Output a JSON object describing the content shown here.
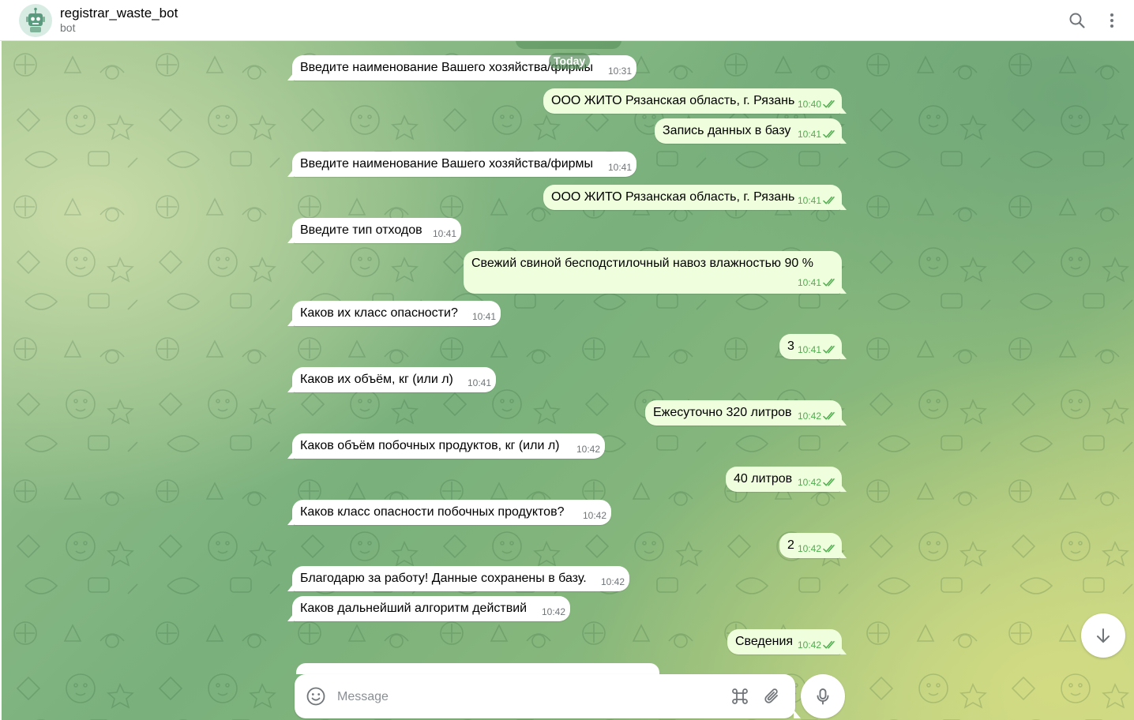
{
  "header": {
    "title": "registrar_waste_bot",
    "subtitle": "bot",
    "avatar_icon": "robot-avatar-icon",
    "search_icon": "search-icon",
    "menu_icon": "more-vertical-icon"
  },
  "chat": {
    "date_label": "Today",
    "messages": [
      {
        "dir": "in",
        "text": "Введите наименование Вашего хозяйства/фирмы",
        "time": "10:31"
      },
      {
        "dir": "out",
        "text": "ООО ЖИТО Рязанская область, г. Рязань",
        "time": "10:40",
        "read": true
      },
      {
        "dir": "out",
        "text": "Запись данных в базу",
        "time": "10:41",
        "read": true
      },
      {
        "dir": "in",
        "text": "Введите наименование Вашего хозяйства/фирмы",
        "time": "10:41"
      },
      {
        "dir": "out",
        "text": "ООО ЖИТО Рязанская область, г. Рязань",
        "time": "10:41",
        "read": true
      },
      {
        "dir": "in",
        "text": "Введите тип отходов",
        "time": "10:41"
      },
      {
        "dir": "out",
        "text": "Свежий свиной бесподстилочный навоз влажностью 90 %",
        "time": "10:41",
        "read": true
      },
      {
        "dir": "in",
        "text": "Каков их класс опасности?",
        "time": "10:41"
      },
      {
        "dir": "out",
        "text": "3",
        "time": "10:41",
        "read": true
      },
      {
        "dir": "in",
        "text": "Каков их объём, кг (или л)",
        "time": "10:41"
      },
      {
        "dir": "out",
        "text": "Ежесуточно 320 литров",
        "time": "10:42",
        "read": true
      },
      {
        "dir": "in",
        "text": "Каков объём побочных продуктов, кг (или л)",
        "time": "10:42"
      },
      {
        "dir": "out",
        "text": "40 литров",
        "time": "10:42",
        "read": true
      },
      {
        "dir": "in",
        "text": "Каков класс опасности побочных продуктов?",
        "time": "10:42"
      },
      {
        "dir": "out",
        "text": "2",
        "time": "10:42",
        "read": true
      },
      {
        "dir": "in",
        "text": "Благодарю за работу! Данные сохранены в базу.",
        "time": "10:42"
      },
      {
        "dir": "in",
        "text": "Каков дальнейший алгоритм действий",
        "time": "10:42"
      },
      {
        "dir": "out",
        "text": "Сведения",
        "time": "10:42",
        "read": true
      }
    ]
  },
  "composer": {
    "placeholder": "Message",
    "emoji_icon": "smile-icon",
    "command_icon": "command-icon",
    "attach_icon": "paperclip-icon",
    "mic_icon": "microphone-icon"
  },
  "scroll_down_icon": "arrow-down-icon",
  "colors": {
    "incoming_bubble": "#ffffff",
    "outgoing_bubble": "#effedd",
    "read_check": "#4fae4e",
    "time_text": "#707579"
  }
}
